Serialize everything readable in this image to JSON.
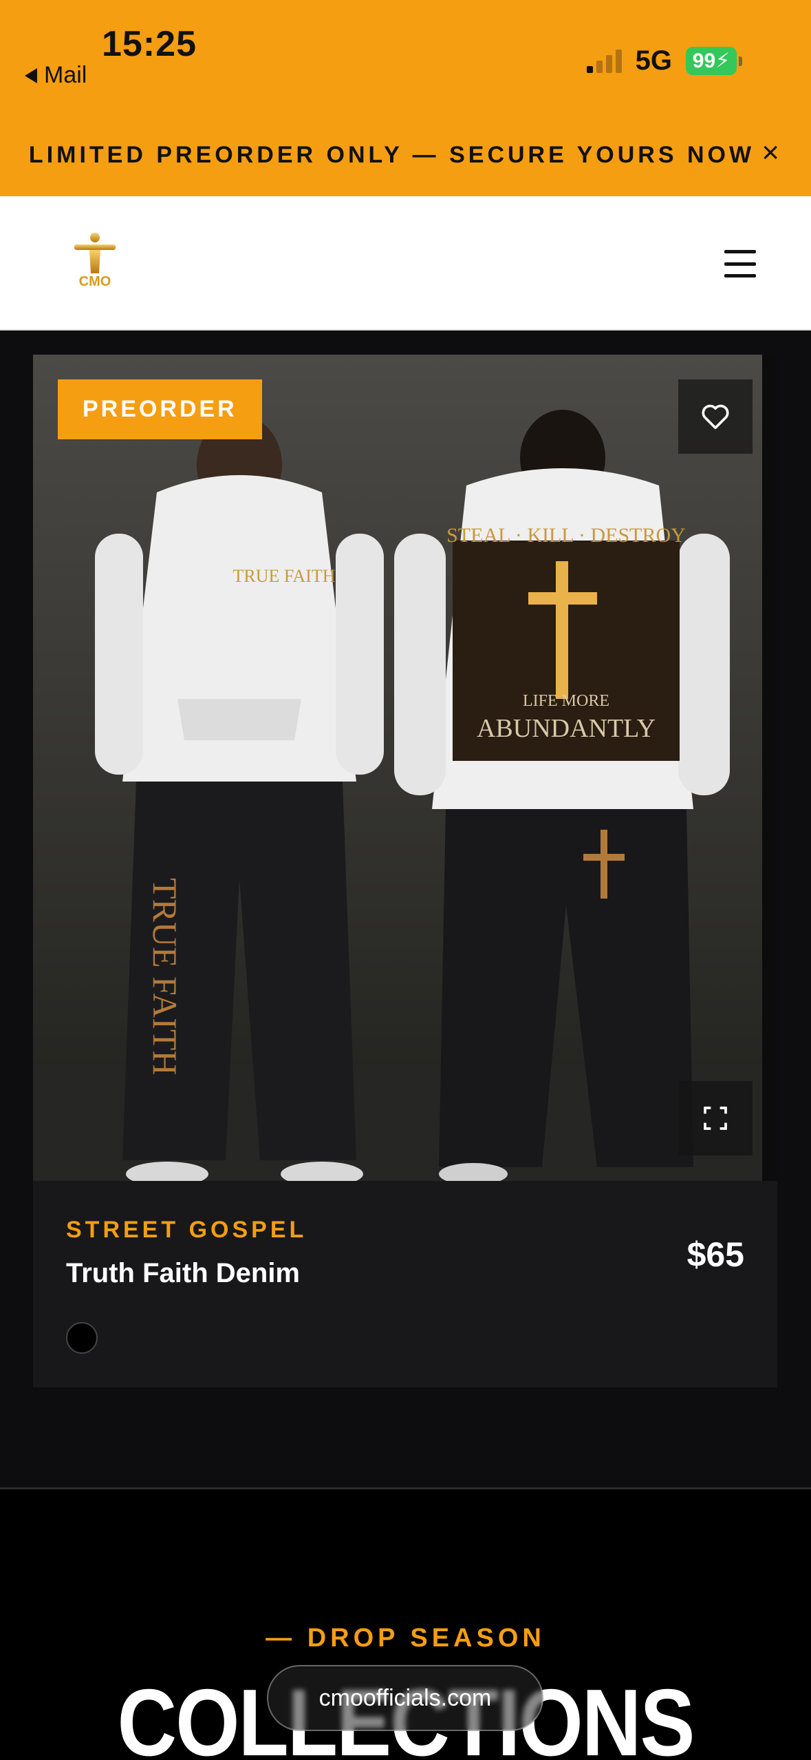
{
  "status_bar": {
    "time": "15:25",
    "back_app": "Mail",
    "network": "5G",
    "battery": "99"
  },
  "promo_bar": {
    "text": "LIMITED PREORDER ONLY — SECURE YOURS NOW",
    "close_symbol": "×"
  },
  "header": {
    "logo_icon": "cmo-logo-icon",
    "menu_icon": "hamburger-menu-icon"
  },
  "product": {
    "badge": "PREORDER",
    "collection": "STREET GOSPEL",
    "name": "Truth Faith Denim",
    "price": "$65",
    "swatch_color": "#000000",
    "favorite_icon": "heart-icon",
    "expand_icon": "fullscreen-icon",
    "photo_text": {
      "hoodie_front": "TRUE FAITH",
      "hoodie_back_top": "STEAL · KILL · DESTROY",
      "hoodie_back_mid": "LIFE MORE",
      "hoodie_back_big": "ABUNDANTLY",
      "jeans_leg": "TRUE FAITH"
    }
  },
  "drop_section": {
    "eyebrow": "— DROP SEASON",
    "title": "COLLECTIONS"
  },
  "browser": {
    "url": "cmoofficials.com"
  },
  "colors": {
    "accent": "#f59e12",
    "card_bg": "#18181b",
    "page_bg": "#0d0d10"
  }
}
